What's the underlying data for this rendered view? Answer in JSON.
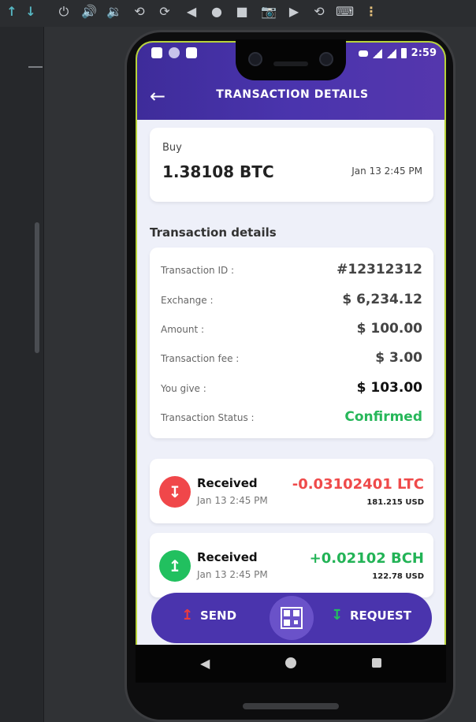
{
  "ide": {
    "toolbar": [
      {
        "name": "arrow-up-icon",
        "glyph": "↑"
      },
      {
        "name": "arrow-down-icon",
        "glyph": "↓"
      },
      {
        "name": "power-icon",
        "glyph": "⏻"
      },
      {
        "name": "volume-up-icon",
        "glyph": "🔊"
      },
      {
        "name": "volume-down-icon",
        "glyph": "🔉"
      },
      {
        "name": "rotate-left-icon",
        "glyph": "⟲"
      },
      {
        "name": "rotate-right-icon",
        "glyph": "⟳"
      },
      {
        "name": "back-icon",
        "glyph": "◀"
      },
      {
        "name": "home-icon",
        "glyph": "●"
      },
      {
        "name": "overview-icon",
        "glyph": "■"
      },
      {
        "name": "camera-icon",
        "glyph": "📷"
      },
      {
        "name": "video-icon",
        "glyph": "▶"
      },
      {
        "name": "restore-icon",
        "glyph": "⟲"
      },
      {
        "name": "keyboard-icon",
        "glyph": "⌨"
      },
      {
        "name": "more-options-icon",
        "glyph": "⋮"
      }
    ]
  },
  "status_bar": {
    "time": "2:59"
  },
  "header": {
    "back_glyph": "←",
    "title": "TRANSACTION DETAILS"
  },
  "buy": {
    "type": "Buy",
    "amount": "1.38108 BTC",
    "date": "Jan 13 2:45 PM"
  },
  "details": {
    "section_title": "Transaction details",
    "rows": [
      {
        "label": "Transaction ID :",
        "value": "#12312312",
        "style": "normal"
      },
      {
        "label": "Exchange :",
        "value": "$ 6,234.12",
        "style": "normal"
      },
      {
        "label": "Amount :",
        "value": "$ 100.00",
        "style": "normal"
      },
      {
        "label": "Transaction fee :",
        "value": "$ 3.00",
        "style": "normal"
      },
      {
        "label": "You give :",
        "value": "$ 103.00",
        "style": "dark"
      },
      {
        "label": "Transaction Status :",
        "value": "Confirmed",
        "style": "green"
      }
    ]
  },
  "transactions": [
    {
      "label": "Received",
      "date": "Jan 13 2:45 PM",
      "amount": "-0.03102401 LTC",
      "usd": "181.215 USD",
      "icon": "arrow-down-icon",
      "glyph": "↧",
      "color": "red"
    },
    {
      "label": "Received",
      "date": "Jan 13 2:45 PM",
      "amount": "+0.02102 BCH",
      "usd": "122.78 USD",
      "icon": "arrow-up-icon",
      "glyph": "↥",
      "color": "green"
    }
  ],
  "bottom_bar": {
    "send_label": "SEND",
    "send_glyph": "↥",
    "request_label": "REQUEST",
    "request_glyph": "↧"
  },
  "phone_nav": {
    "back_glyph": "◀"
  },
  "colors": {
    "primary": "#4a34ad",
    "confirmed": "#27b75a",
    "negative": "#ef4a4a",
    "positive": "#22b356"
  }
}
